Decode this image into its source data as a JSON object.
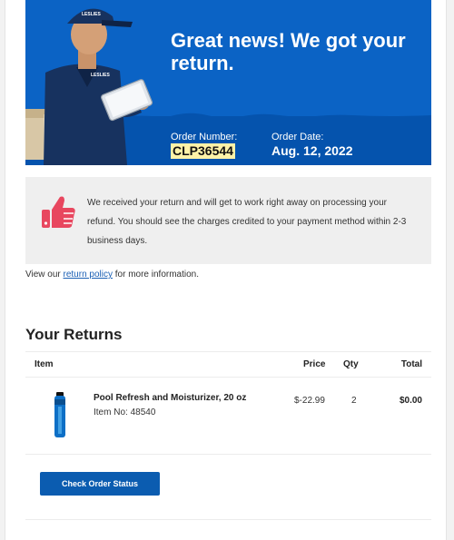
{
  "hero": {
    "title": "Great news! We got your return.",
    "order_number_label": "Order Number:",
    "order_number": "CLP36544",
    "order_date_label": "Order Date:",
    "order_date": "Aug. 12, 2022",
    "cap_logo_text": "LESLIES",
    "shirt_logo_text": "LESLIES"
  },
  "notice": {
    "message": "We received your return and will get to work right away on processing your refund. You should see the charges credited to your payment method within 2-3 business days."
  },
  "policy": {
    "prefix": "View our ",
    "link": "return policy",
    "suffix": " for more information."
  },
  "returns": {
    "title": "Your Returns",
    "headers": {
      "item": "Item",
      "price": "Price",
      "qty": "Qty",
      "total": "Total"
    },
    "items": [
      {
        "name": "Pool Refresh and Moisturizer, 20 oz",
        "item_no": "Item No: 48540",
        "price": "$-22.99",
        "qty": "2",
        "total": "$0.00"
      }
    ]
  },
  "actions": {
    "check_status": "Check Order Status"
  },
  "colors": {
    "brand_blue": "#0b63c5",
    "button_blue": "#0b5cb0",
    "thumb_pink": "#e8475f",
    "highlight": "#fff2a8"
  }
}
